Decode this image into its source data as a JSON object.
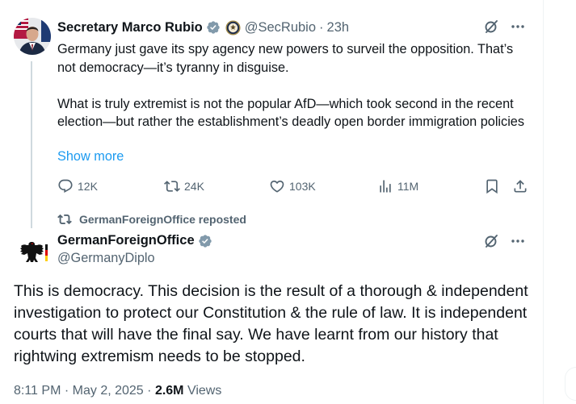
{
  "colors": {
    "link": "#1d9bf0",
    "secondary_text": "#536471",
    "verified": "#829aab",
    "thread_line": "#cfd9de"
  },
  "quoted_post": {
    "author_name": "Secretary Marco Rubio",
    "handle": "@SecRubio",
    "separator": "·",
    "time": "23h",
    "paragraph_1": "Germany just gave its spy agency new powers to surveil the opposition. That’s not democracy—it’s tyranny in disguise.",
    "paragraph_2": "What is truly extremist is not the popular AfD—which took second in the recent election—but rather the establishment’s deadly open border immigration policies",
    "show_more": "Show more",
    "stats": {
      "replies": "12K",
      "reposts": "24K",
      "likes": "103K",
      "views": "11M"
    }
  },
  "repost_bar": {
    "text": "GermanForeignOffice reposted"
  },
  "main_post": {
    "author_name": "GermanForeignOffice",
    "handle": "@GermanyDiplo",
    "body": "This is democracy. This decision is the result of a thorough & independent investigation to protect our Constitution & the rule of law. It is independent courts that will have the final say. We have learnt from our history that rightwing extremism needs to be stopped.",
    "time": "8:11 PM",
    "separator": "·",
    "date": "May 2, 2025",
    "views_count": "2.6M",
    "views_label": "Views"
  },
  "icons": [
    "verified-badge-icon",
    "government-seal-icon",
    "grok-icon",
    "more-icon",
    "reply-icon",
    "repost-icon",
    "like-icon",
    "views-icon",
    "bookmark-icon",
    "share-icon",
    "eagle-logo-icon"
  ]
}
